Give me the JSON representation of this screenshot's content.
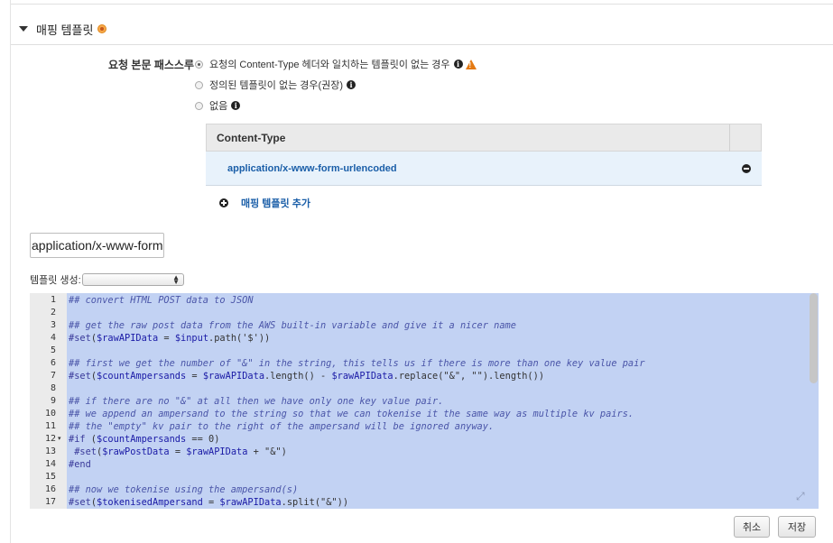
{
  "section": {
    "title": "매핑 템플릿"
  },
  "passthrough": {
    "label": "요청 본문 패스스루",
    "options": [
      {
        "label": "요청의 Content-Type 헤더와 일치하는 템플릿이 없는 경우",
        "selected": true,
        "warning": true
      },
      {
        "label": "정의된 템플릿이 없는 경우(권장)",
        "selected": false,
        "warning": false
      },
      {
        "label": "없음",
        "selected": false,
        "warning": false
      }
    ]
  },
  "content_type_table": {
    "header": "Content-Type",
    "rows": [
      "application/x-www-form-urlencoded"
    ],
    "add_label": "매핑 템플릿 추가"
  },
  "content_type_input": {
    "value": "application/x-www-form-urlencoded"
  },
  "template_gen": {
    "label": "템플릿 생성:",
    "selected": ""
  },
  "editor": {
    "lines": [
      "## convert HTML POST data to JSON",
      "",
      "## get the raw post data from the AWS built-in variable and give it a nicer name",
      "#set($rawAPIData = $input.path('$'))",
      "",
      "## first we get the number of \"&\" in the string, this tells us if there is more than one key value pair",
      "#set($countAmpersands = $rawAPIData.length() - $rawAPIData.replace(\"&\", \"\").length())",
      "",
      "## if there are no \"&\" at all then we have only one key value pair.",
      "## we append an ampersand to the string so that we can tokenise it the same way as multiple kv pairs.",
      "## the \"empty\" kv pair to the right of the ampersand will be ignored anyway.",
      "#if ($countAmpersands == 0)",
      " #set($rawPostData = $rawAPIData + \"&\")",
      "#end",
      "",
      "## now we tokenise using the ampersand(s)",
      "#set($tokenisedAmpersand = $rawAPIData.split(\"&\"))"
    ]
  },
  "buttons": {
    "cancel": "취소",
    "save": "저장"
  }
}
